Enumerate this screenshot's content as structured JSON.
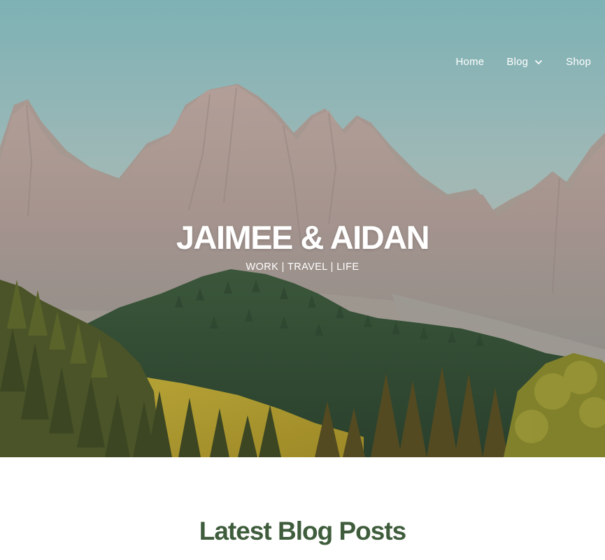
{
  "nav": {
    "items": [
      {
        "label": "Home"
      },
      {
        "label": "Blog",
        "has_dropdown": true
      },
      {
        "label": "Shop"
      }
    ]
  },
  "hero": {
    "title": "JAIMEE & AIDAN",
    "subtitle": "WORK | TRAVEL | LIFE"
  },
  "main": {
    "section_title": "Latest Blog Posts"
  },
  "colors": {
    "sky": "#8fc0c2",
    "mountain": "#b6a6a0",
    "forest": "#355335",
    "meadow": "#c9b23a",
    "heading_green": "#3f5d3c",
    "nav_text": "#ffffff"
  },
  "icons": {
    "blog_dropdown": "chevron-down-icon"
  }
}
